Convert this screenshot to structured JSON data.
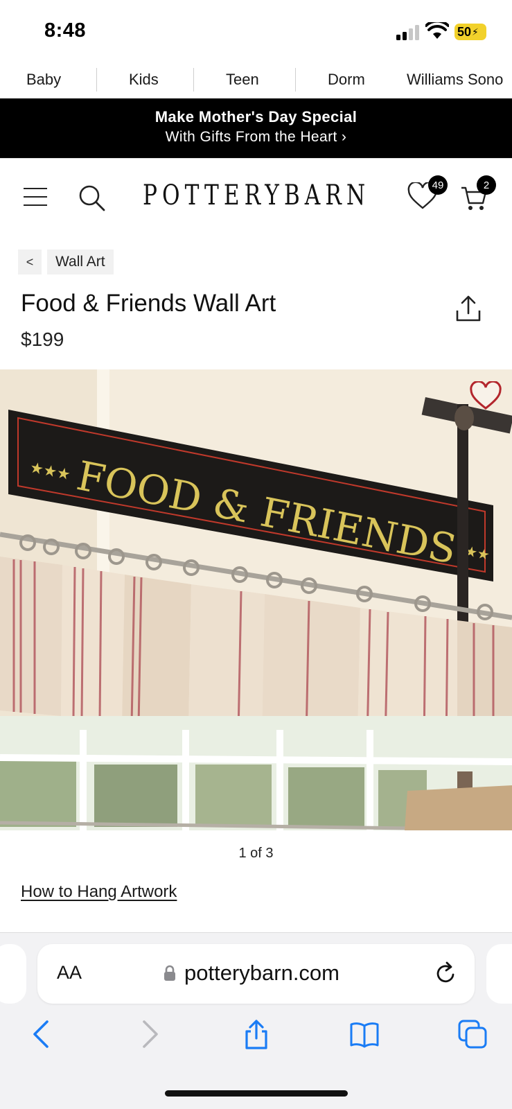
{
  "status_bar": {
    "time": "8:48",
    "battery": "50",
    "battery_color": "#f2d12b"
  },
  "brand_tabs": [
    "Baby",
    "Kids",
    "Teen",
    "Dorm",
    "Williams Sono"
  ],
  "promo": {
    "line1": "Make Mother's Day Special",
    "line2": "With Gifts From the Heart ›"
  },
  "header": {
    "menu_icon": "hamburger-menu-icon",
    "search_icon": "search-icon",
    "logo": "POTTERYBARN",
    "wishlist_count": "49",
    "cart_count": "2"
  },
  "breadcrumb": {
    "back": "<",
    "label": "Wall Art"
  },
  "product": {
    "title": "Food & Friends Wall Art",
    "price": "$199",
    "image_sign_text": "FOOD & FRIENDS",
    "image_pager": "1 of 3",
    "how_to_link": "How to Hang Artwork"
  },
  "browser": {
    "aa": "AA",
    "url": "potterybarn.com",
    "buttons": [
      "back-icon",
      "forward-icon",
      "share-icon",
      "bookmarks-icon",
      "tabs-icon"
    ],
    "accent": "#1a7cf5"
  }
}
